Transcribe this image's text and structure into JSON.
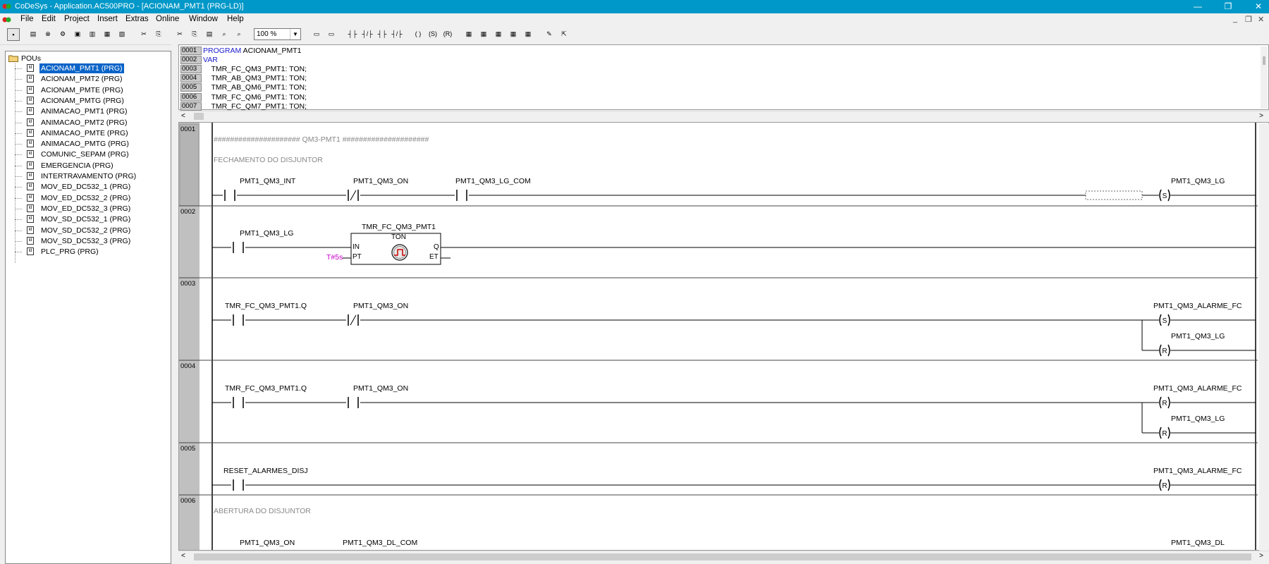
{
  "window": {
    "title": "CoDeSys - Application.AC500PRO - [ACIONAM_PMT1 (PRG-LD)]",
    "buttons": {
      "minimize": "—",
      "restore": "❐",
      "close": "✕"
    }
  },
  "menu": [
    "File",
    "Edit",
    "Project",
    "Insert",
    "Extras",
    "Online",
    "Window",
    "Help"
  ],
  "mdi_controls": {
    "minimize": "_",
    "restore": "❐",
    "close": "✕"
  },
  "toolbar": {
    "zoom": "100 %"
  },
  "tree": {
    "root": "POUs",
    "items": [
      "ACIONAM_PMT1 (PRG)",
      "ACIONAM_PMT2 (PRG)",
      "ACIONAM_PMTE (PRG)",
      "ACIONAM_PMTG (PRG)",
      "ANIMACAO_PMT1 (PRG)",
      "ANIMACAO_PMT2 (PRG)",
      "ANIMACAO_PMTE (PRG)",
      "ANIMACAO_PMTG (PRG)",
      "COMUNIC_SEPAM (PRG)",
      "EMERGENCIA (PRG)",
      "INTERTRAVAMENTO (PRG)",
      "MOV_ED_DC532_1 (PRG)",
      "MOV_ED_DC532_2 (PRG)",
      "MOV_ED_DC532_3 (PRG)",
      "MOV_SD_DC532_1 (PRG)",
      "MOV_SD_DC532_2 (PRG)",
      "MOV_SD_DC532_3 (PRG)",
      "PLC_PRG (PRG)"
    ],
    "selected_index": 0
  },
  "declaration": {
    "lines": [
      {
        "num": "0001",
        "kw": "PROGRAM",
        "text": " ACIONAM_PMT1"
      },
      {
        "num": "0002",
        "kw": "VAR",
        "text": ""
      },
      {
        "num": "0003",
        "kw": "",
        "text": "    TMR_FC_QM3_PMT1: TON;"
      },
      {
        "num": "0004",
        "kw": "",
        "text": "    TMR_AB_QM3_PMT1: TON;"
      },
      {
        "num": "0005",
        "kw": "",
        "text": "    TMR_AB_QM6_PMT1: TON;"
      },
      {
        "num": "0006",
        "kw": "",
        "text": "    TMR_FC_QM6_PMT1: TON;"
      },
      {
        "num": "0007",
        "kw": "",
        "text": "    TMR_FC_QM7_PMT1: TON;"
      }
    ]
  },
  "ladder": {
    "rung1": {
      "num": "0001",
      "comment1": "##################### QM3-PMT1 #####################",
      "comment2": "FECHAMENTO DO DISJUNTOR",
      "c1": "PMT1_QM3_INT",
      "c2": "PMT1_QM3_ON",
      "c3": "PMT1_QM3_LG_COM",
      "coil": "PMT1_QM3_LG",
      "coil_type": "S"
    },
    "rung2": {
      "num": "0002",
      "c1": "PMT1_QM3_LG",
      "fb_instance": "TMR_FC_QM3_PMT1",
      "fb_type": "TON",
      "in": "IN",
      "pt": "PT",
      "q": "Q",
      "et": "ET",
      "pt_value": "T#5s"
    },
    "rung3": {
      "num": "0003",
      "c1": "TMR_FC_QM3_PMT1.Q",
      "c2": "PMT1_QM3_ON",
      "coil1": "PMT1_QM3_ALARME_FC",
      "coil1_type": "S",
      "coil2": "PMT1_QM3_LG",
      "coil2_type": "R"
    },
    "rung4": {
      "num": "0004",
      "c1": "TMR_FC_QM3_PMT1.Q",
      "c2": "PMT1_QM3_ON",
      "coil1": "PMT1_QM3_ALARME_FC",
      "coil1_type": "R",
      "coil2": "PMT1_QM3_LG",
      "coil2_type": "R"
    },
    "rung5": {
      "num": "0005",
      "c1": "RESET_ALARMES_DISJ",
      "coil": "PMT1_QM3_ALARME_FC",
      "coil_type": "R"
    },
    "rung6": {
      "num": "0006",
      "comment": "ABERTURA DO DISJUNTOR",
      "c1": "PMT1_QM3_ON",
      "c2": "PMT1_QM3_DL_COM",
      "coil": "PMT1_QM3_DL"
    }
  },
  "colors": {
    "titlebar": "#0098c8",
    "selection": "#0a64c8",
    "keyword": "#1a1acc",
    "constant": "#cc00cc",
    "comment": "#888888"
  }
}
